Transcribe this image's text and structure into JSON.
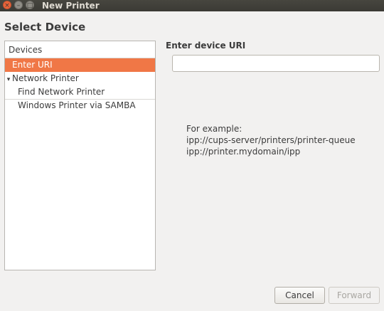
{
  "window": {
    "title": "New Printer",
    "close_glyph": "×",
    "minimize_glyph": "–",
    "maximize_glyph": "□"
  },
  "section_title": "Select Device",
  "devices": {
    "header": "Devices",
    "items": [
      {
        "label": "Enter URI",
        "selected": true
      },
      {
        "label": "Network Printer",
        "expander": "▾"
      },
      {
        "label": "Find Network Printer"
      },
      {
        "label": "Windows Printer via SAMBA"
      }
    ]
  },
  "uri": {
    "label": "Enter device URI",
    "value": "",
    "placeholder": ""
  },
  "example": {
    "intro": "For example:",
    "line1": "ipp://cups-server/printers/printer-queue",
    "line2": "ipp://printer.mydomain/ipp"
  },
  "buttons": {
    "cancel": "Cancel",
    "forward": "Forward"
  },
  "colors": {
    "accent": "#f07746",
    "titlebar": "#3b3a35"
  }
}
